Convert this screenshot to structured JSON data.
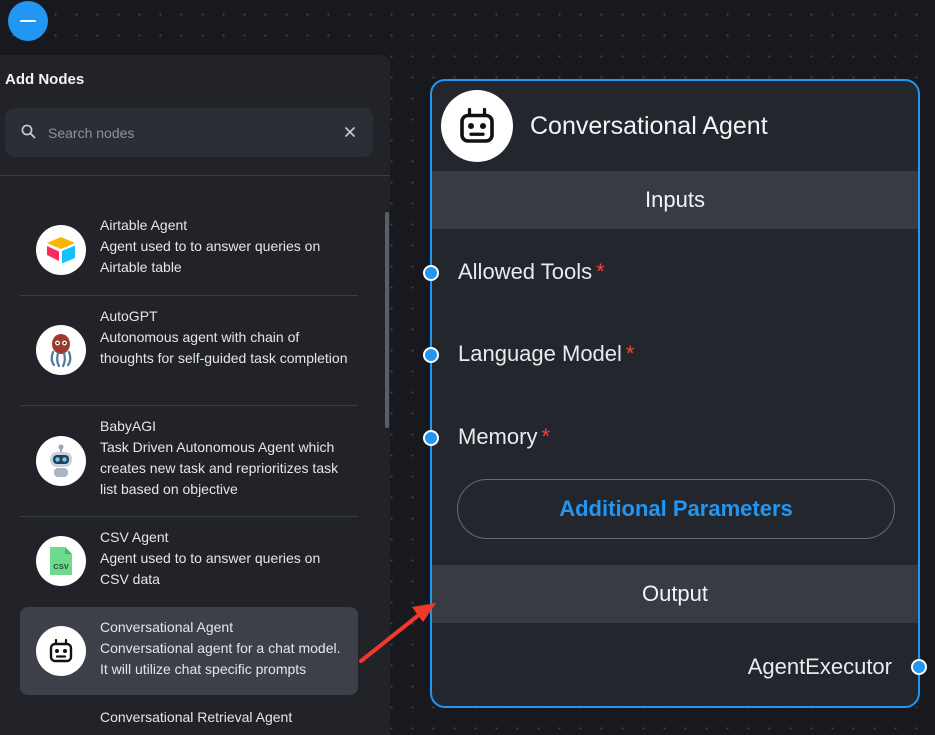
{
  "fab": {
    "icon": "minus-icon"
  },
  "panel": {
    "title": "Add Nodes",
    "search": {
      "placeholder": "Search nodes",
      "value": ""
    },
    "items": [
      {
        "name": "Airtable Agent",
        "description": "Agent used to to answer queries on Airtable table",
        "icon": "airtable-logo-icon"
      },
      {
        "name": "AutoGPT",
        "description": "Autonomous agent with chain of thoughts for self-guided task completion",
        "icon": "autogpt-logo-icon"
      },
      {
        "name": "BabyAGI",
        "description": "Task Driven Autonomous Agent which creates new task and reprioritizes task list based on objective",
        "icon": "babyagi-robot-icon"
      },
      {
        "name": "CSV Agent",
        "description": "Agent used to to answer queries on CSV data",
        "icon": "csv-file-icon"
      },
      {
        "name": "Conversational Agent",
        "description": "Conversational agent for a chat model. It will utilize chat specific prompts",
        "icon": "robot-icon",
        "selected": true
      },
      {
        "name": "Conversational Retrieval Agent",
        "description": "",
        "icon": ""
      }
    ]
  },
  "node": {
    "title": "Conversational Agent",
    "icon": "robot-icon",
    "inputs_label": "Inputs",
    "params": [
      {
        "label": "Allowed Tools",
        "required": "*"
      },
      {
        "label": "Language Model",
        "required": "*"
      },
      {
        "label": "Memory",
        "required": "*"
      }
    ],
    "additional_params_label": "Additional Parameters",
    "output_label": "Output",
    "output_value": "AgentExecutor"
  },
  "colors": {
    "accent": "#2196f3",
    "required": "#f44336",
    "annotation_arrow": "#f0392b"
  }
}
